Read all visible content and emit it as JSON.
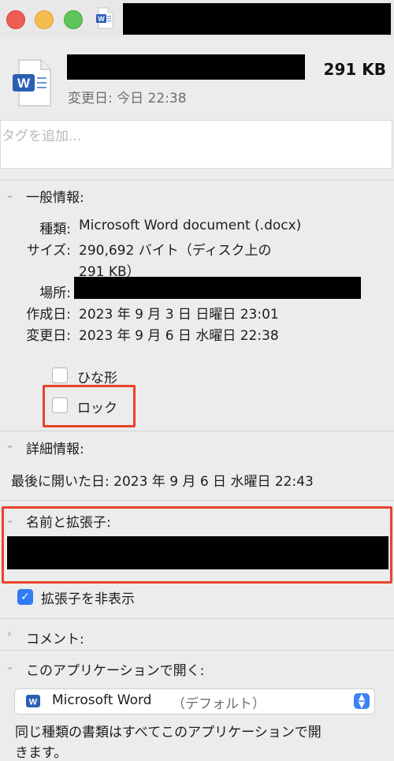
{
  "header": {
    "file_size": "291 KB",
    "modified": "変更日: 今日 22:38"
  },
  "tags": {
    "placeholder": "タグを追加..."
  },
  "general": {
    "title": "一般情報:",
    "kind_label": "種類:",
    "kind_value": "Microsoft Word document (.docx)",
    "size_label": "サイズ:",
    "size_value_line1": "290,692 バイト（ディスク上の",
    "size_value_line2": "291 KB）",
    "where_label": "場所:",
    "created_label": "作成日:",
    "created_value": "2023 年 9 月 3 日 日曜日 23:01",
    "modified_label": "変更日:",
    "modified_value": "2023 年 9 月 6 日 水曜日 22:38",
    "stationery_label": "ひな形",
    "locked_label": "ロック"
  },
  "more_info": {
    "title": "詳細情報:",
    "last_opened": "最後に開いた日: 2023 年 9 月 6 日 水曜日 22:43"
  },
  "name_ext": {
    "title": "名前と拡張子:",
    "hide_ext_label": "拡張子を非表示",
    "hide_ext_checked": true
  },
  "comments": {
    "title": "コメント:"
  },
  "open_with": {
    "title": "このアプリケーションで開く:",
    "app_name": "Microsoft Word",
    "app_default": "（デフォルト）",
    "note": "同じ種類の書類はすべてこのアプリケーションで開",
    "note_line2": "きます。"
  },
  "colors": {
    "highlight": "#e8442c",
    "checkbox_blue": "#2f7cf6",
    "word_blue": "#2b5fb4"
  }
}
